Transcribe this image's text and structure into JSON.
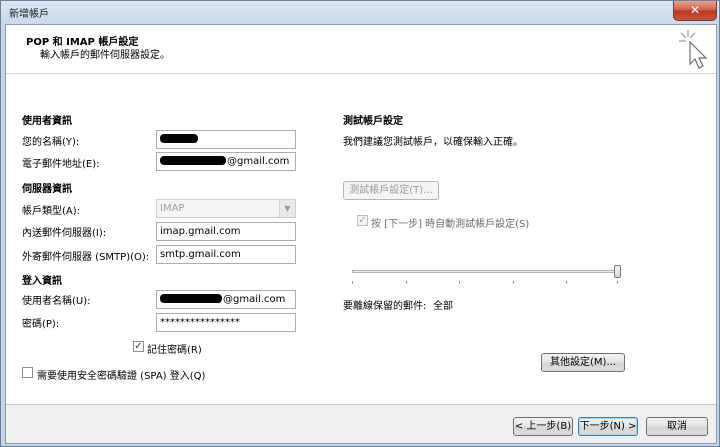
{
  "window": {
    "title": "新增帳戶",
    "close_label": "✕"
  },
  "header": {
    "title": "POP 和 IMAP 帳戶設定",
    "subtitle": "輸入帳戶的郵件伺服器設定。"
  },
  "user_info": {
    "heading": "使用者資訊",
    "name_label": "您的名稱(Y):",
    "email_label": "電子郵件地址(E):",
    "email_value": "@gmail.com"
  },
  "server_info": {
    "heading": "伺服器資訊",
    "account_type_label": "帳戶類型(A):",
    "account_type_value": "IMAP",
    "incoming_label": "內送郵件伺服器(I):",
    "incoming_value": "imap.gmail.com",
    "outgoing_label": "外寄郵件伺服器 (SMTP)(O):",
    "outgoing_value": "smtp.gmail.com"
  },
  "logon_info": {
    "heading": "登入資訊",
    "username_label": "使用者名稱(U):",
    "username_value": "@gmail.com",
    "password_label": "密碼(P):",
    "password_value": "****************",
    "remember_label": "記住密碼(R)",
    "remember_checked": true,
    "spa_label": "需要使用安全密碼驗證 (SPA) 登入(Q)",
    "spa_checked": false
  },
  "test_settings": {
    "heading": "測試帳戶設定",
    "description": "我們建議您測試帳戶，以確保輸入正確。",
    "test_button": "測試帳戶設定(T)...",
    "auto_test_label": "按 [下一步] 時自動測試帳戶設定(S)",
    "auto_test_checked": true
  },
  "offline": {
    "label": "要離線保留的郵件:",
    "value": "全部",
    "level": 1.0
  },
  "more_settings_button": "其他設定(M)...",
  "footer": {
    "back_button": "< 上一步(B)",
    "next_button": "下一步(N) >",
    "cancel_button": "取消"
  }
}
